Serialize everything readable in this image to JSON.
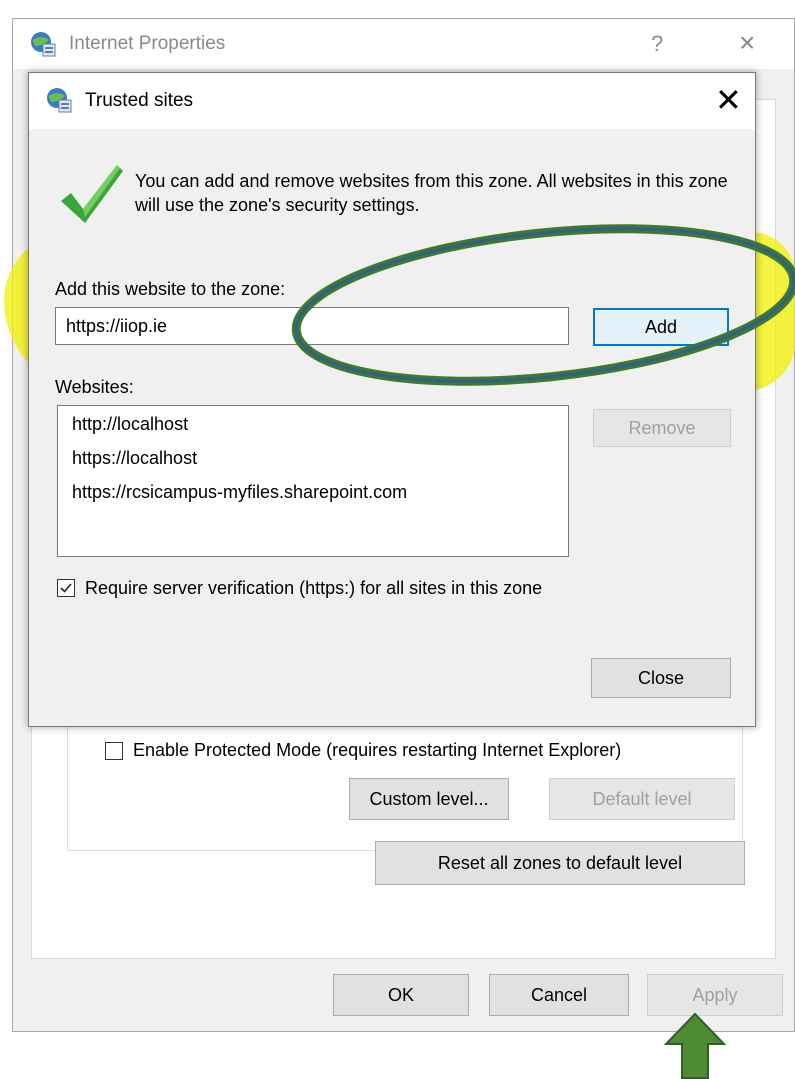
{
  "outer_window": {
    "title": "Internet Properties",
    "help_glyph": "?",
    "close_glyph": "×",
    "enable_protected_mode_label": "Enable Protected Mode (requires restarting Internet Explorer)",
    "enable_protected_mode_checked": false,
    "custom_level_label": "Custom level...",
    "default_level_label": "Default level",
    "reset_all_zones_label": "Reset all zones to default level",
    "ok_label": "OK",
    "cancel_label": "Cancel",
    "apply_label": "Apply"
  },
  "dialog": {
    "title": "Trusted sites",
    "close_glyph": "✕",
    "info_text": "You can add and remove websites from this zone. All websites in this zone will use the zone's security settings.",
    "add_label": "Add this website to the zone:",
    "add_input_value": "https://iiop.ie",
    "add_button_label": "Add",
    "websites_label": "Websites:",
    "websites": [
      "http://localhost",
      "https://localhost",
      "https://rcsicampus-myfiles.sharepoint.com"
    ],
    "remove_button_label": "Remove",
    "require_verification_label": "Require server verification (https:) for all sites in this zone",
    "require_verification_checked": true,
    "close_button_label": "Close"
  },
  "icons": {
    "window_icon": "globe-settings-icon",
    "check_icon": "green-checkmark-icon"
  },
  "colors": {
    "highlight": "#f2f000",
    "annotation_green": "#3f7a2a",
    "annotation_ellipse_inner": "#2f5f8f",
    "focus_border": "#0078d7",
    "checkmark": "#3aa63a"
  }
}
